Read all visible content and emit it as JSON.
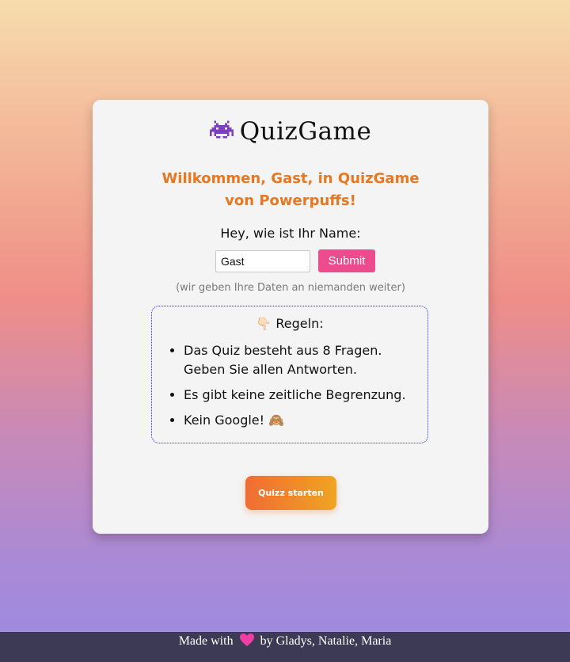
{
  "header": {
    "title": "QuizGame",
    "icon": "space-invader-icon"
  },
  "welcome": "Willkommen, Gast, in QuizGame von Powerpuffs!",
  "name_prompt": "Hey, wie ist Ihr Name:",
  "name_input": {
    "value": "Gast"
  },
  "submit_label": "Submit",
  "privacy_note": "(wir geben Ihre Daten an niemanden weiter)",
  "rules": {
    "heading": "👇🏻 Regeln:",
    "items": [
      {
        "line1": "Das Quiz besteht aus 8 Fragen.",
        "line2": "Geben Sie allen Antworten."
      },
      {
        "line1": "Es gibt keine zeitliche Begrenzung."
      },
      {
        "line1": "Kein Google! 🙈"
      }
    ]
  },
  "start_button": "Quizz starten",
  "footer": {
    "before": "Made with",
    "after": "by Gladys, Natalie, Maria",
    "icon": "heart-icon"
  },
  "colors": {
    "accent_orange": "#e77721",
    "submit_pink": "#ec4b8d",
    "footer_bg": "#3d3a56"
  }
}
